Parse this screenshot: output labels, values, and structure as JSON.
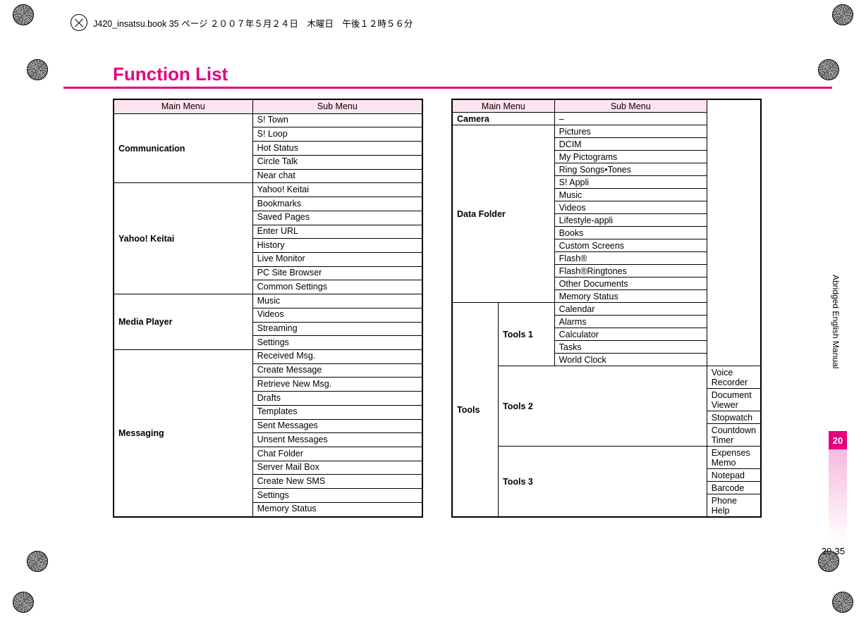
{
  "header_line": "J420_insatsu.book 35 ページ ２００７年５月２４日　木曜日　午後１２時５６分",
  "title": "Function List",
  "table_headers": {
    "main": "Main Menu",
    "sub": "Sub Menu"
  },
  "left_table": [
    {
      "main": "Communication",
      "subs": [
        "S! Town",
        "S! Loop",
        "Hot Status",
        "Circle Talk",
        "Near chat"
      ]
    },
    {
      "main": "Yahoo! Keitai",
      "subs": [
        "Yahoo! Keitai",
        "Bookmarks",
        "Saved Pages",
        "Enter URL",
        "History",
        "Live Monitor",
        "PC Site Browser",
        "Common Settings"
      ]
    },
    {
      "main": "Media Player",
      "subs": [
        "Music",
        "Videos",
        "Streaming",
        "Settings"
      ]
    },
    {
      "main": "Messaging",
      "subs": [
        "Received Msg.",
        "Create Message",
        "Retrieve New Msg.",
        "Drafts",
        "Templates",
        "Sent Messages",
        "Unsent Messages",
        "Chat Folder",
        "Server Mail Box",
        "Create New SMS",
        "Settings",
        "Memory Status"
      ]
    }
  ],
  "right_table": {
    "simple": [
      {
        "main": "Camera",
        "subs": [
          "–"
        ]
      },
      {
        "main": "Data Folder",
        "subs": [
          "Pictures",
          "DCIM",
          "My Pictograms",
          "Ring Songs•Tones",
          "S! Appli",
          "Music",
          "Videos",
          "Lifestyle-appli",
          "Books",
          "Custom Screens",
          "Flash®",
          "Flash®Ringtones",
          "Other Documents",
          "Memory Status"
        ]
      }
    ],
    "tools": {
      "main": "Tools",
      "groups": [
        {
          "name": "Tools 1",
          "subs": [
            "Calendar",
            "Alarms",
            "Calculator",
            "Tasks",
            "World Clock"
          ]
        },
        {
          "name": "Tools 2",
          "subs": [
            "Voice Recorder",
            "Document Viewer",
            "Stopwatch",
            "Countdown Timer"
          ]
        },
        {
          "name": "Tools 3",
          "subs": [
            "Expenses Memo",
            "Notepad",
            "Barcode",
            "Phone Help"
          ]
        }
      ]
    }
  },
  "sidebar_text": "Abridged English Manual",
  "chapter_num": "20",
  "page_number": "20-35"
}
